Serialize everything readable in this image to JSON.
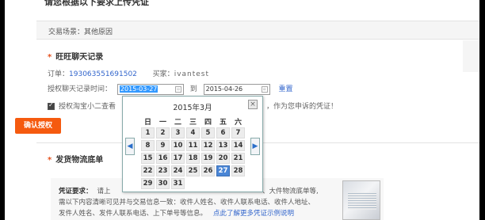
{
  "header": {
    "cut_title": "请您根据以下要求上传凭证"
  },
  "scene": {
    "label": "交易场景：其他原因"
  },
  "wangwang": {
    "title": "旺旺聊天记录",
    "order_label": "订单：",
    "order_no": "193063551691502",
    "buyer_label": "买家：",
    "buyer_name": "ivantest",
    "auth_time_label": "授权聊天记录时间：",
    "start_date": "2015-03-27",
    "to_label": "到",
    "end_date": "2015-04-26",
    "reset": "重置",
    "consent_text_left": "授权淘宝小二查看",
    "consent_text_right": "，作为您申诉的凭证！",
    "confirm_button": "确认授权"
  },
  "calendar": {
    "title": "2015年3月",
    "close": "×",
    "prev": "◀",
    "next": "▶",
    "weekdays": [
      "日",
      "一",
      "二",
      "三",
      "四",
      "五",
      "六"
    ],
    "leading_blanks": 0,
    "days": [
      "1",
      "2",
      "3",
      "4",
      "5",
      "6",
      "7",
      "8",
      "9",
      "10",
      "11",
      "12",
      "13",
      "14",
      "15",
      "16",
      "17",
      "18",
      "19",
      "20",
      "21",
      "22",
      "23",
      "24",
      "25",
      "26",
      "27",
      "28",
      "29",
      "30",
      "31"
    ],
    "selected_day": "27"
  },
  "shipping": {
    "title": "发货物流底单",
    "proof_label": "凭证要求：",
    "proof_line1_left": "请上",
    "proof_line1_right": "、大件物流底单等,",
    "proof_line2_left": "需以下内容清晰可见并与交易信息一致：收件人姓名、收件人联系电话、收件人地址、",
    "proof_line3_left": "发件人姓名、发件人联系电话、上下单号等信息。",
    "proof_line3_link": "点此了解更多凭证示例说明"
  }
}
